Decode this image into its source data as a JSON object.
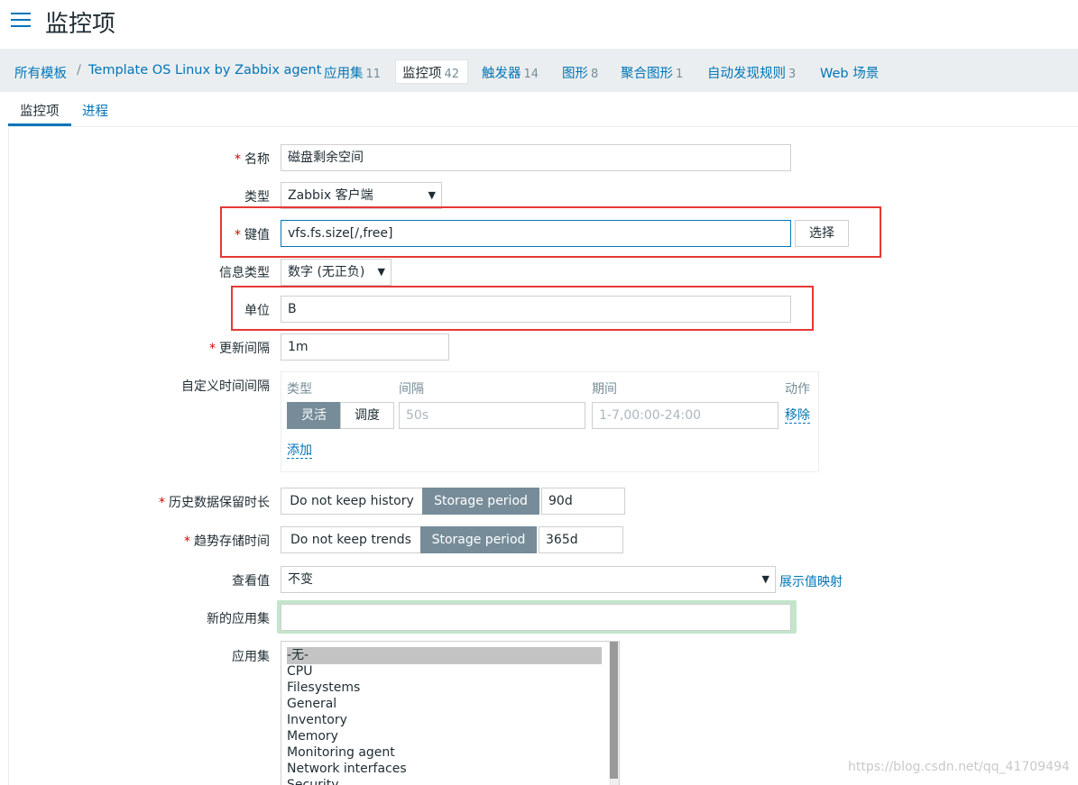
{
  "page": {
    "title": "监控项"
  },
  "breadcrumb": {
    "all_templates": "所有模板",
    "separator": "/",
    "template": "Template OS Linux by Zabbix agent",
    "items": [
      {
        "label": "应用集",
        "count": "11"
      },
      {
        "label": "监控项",
        "count": "42"
      },
      {
        "label": "触发器",
        "count": "14"
      },
      {
        "label": "图形",
        "count": "8"
      },
      {
        "label": "聚合图形",
        "count": "1"
      },
      {
        "label": "自动发现规则",
        "count": "3"
      },
      {
        "label": "Web 场景",
        "count": ""
      }
    ]
  },
  "tabs": [
    {
      "label": "监控项"
    },
    {
      "label": "进程"
    }
  ],
  "form": {
    "required_mark": "*",
    "name": {
      "label": "名称",
      "value": "磁盘剩余空间"
    },
    "type": {
      "label": "类型",
      "value": "Zabbix 客户端"
    },
    "key": {
      "label": "键值",
      "value": "vfs.fs.size[/,free]",
      "select_button": "选择"
    },
    "info_type": {
      "label": "信息类型",
      "value": "数字 (无正负)"
    },
    "units": {
      "label": "单位",
      "value": "B"
    },
    "update_interval": {
      "label": "更新间隔",
      "value": "1m"
    },
    "custom_intervals": {
      "label": "自定义时间间隔",
      "col_type": "类型",
      "col_interval": "间隔",
      "col_period": "期间",
      "col_action": "动作",
      "flexible": "灵活",
      "scheduling": "调度",
      "interval_placeholder": "50s",
      "period_placeholder": "1-7,00:00-24:00",
      "remove": "移除",
      "add": "添加"
    },
    "history": {
      "label": "历史数据保留时长",
      "no_keep": "Do not keep history",
      "storage": "Storage period",
      "value": "90d"
    },
    "trends": {
      "label": "趋势存储时间",
      "no_keep": "Do not keep trends",
      "storage": "Storage period",
      "value": "365d"
    },
    "show_value": {
      "label": "查看值",
      "value": "不变",
      "link": "展示值映射"
    },
    "new_application": {
      "label": "新的应用集",
      "value": ""
    },
    "applications": {
      "label": "应用集",
      "options": [
        "-无-",
        "CPU",
        "Filesystems",
        "General",
        "Inventory",
        "Memory",
        "Monitoring agent",
        "Network interfaces",
        "Security"
      ]
    }
  },
  "watermark": "https://blog.csdn.net/qq_41709494",
  "colors": {
    "accent": "#0275b8",
    "toggle_active": "#768d99",
    "highlight_box": "#e53935",
    "focus_green": "#c3e6cb"
  }
}
